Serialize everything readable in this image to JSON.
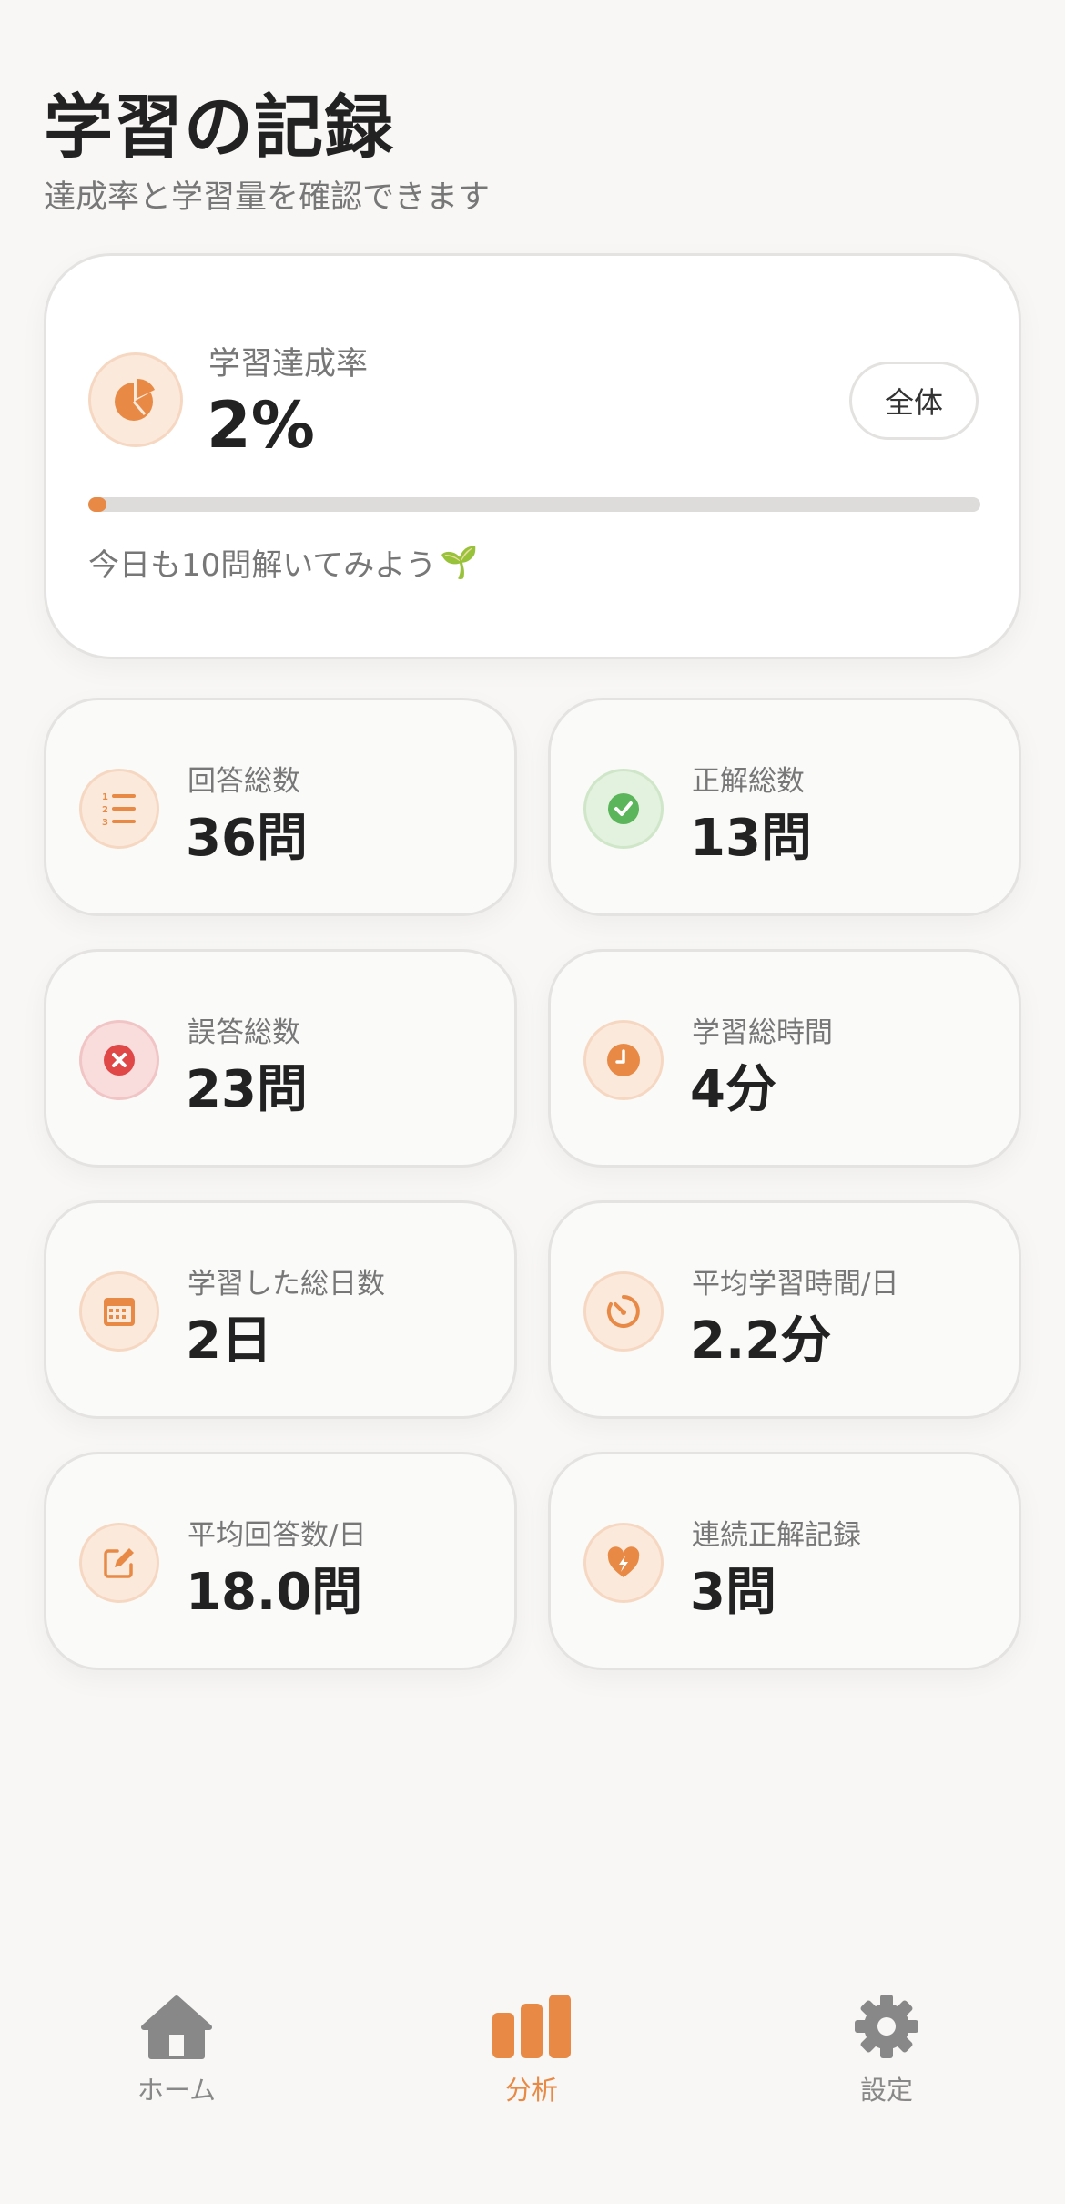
{
  "header": {
    "title": "学習の記録",
    "subtitle": "達成率と学習量を確認できます"
  },
  "summary": {
    "label": "学習達成率",
    "value": "2%",
    "progress_percent": 2,
    "scope_button": "全体",
    "message": "今日も10問解いてみよう",
    "message_emoji": "🌱",
    "icon": "pie-chart-icon"
  },
  "stats": [
    {
      "label": "回答総数",
      "value": "36問",
      "icon": "numbered-list-icon",
      "tint": "#fbe9dc",
      "color": "#e88a45"
    },
    {
      "label": "正解総数",
      "value": "13問",
      "icon": "check-circle-icon",
      "tint": "#e3f1df",
      "color": "#5bb55a"
    },
    {
      "label": "誤答総数",
      "value": "23問",
      "icon": "x-circle-icon",
      "tint": "#f9dcdc",
      "color": "#e04848"
    },
    {
      "label": "学習総時間",
      "value": "4分",
      "icon": "clock-icon",
      "tint": "#fbe9dc",
      "color": "#e88a45"
    },
    {
      "label": "学習した総日数",
      "value": "2日",
      "icon": "calendar-icon",
      "tint": "#fbe9dc",
      "color": "#e88a45"
    },
    {
      "label": "平均学習時間/日",
      "value": "2.2分",
      "icon": "timer-icon",
      "tint": "#fbe9dc",
      "color": "#e88a45"
    },
    {
      "label": "平均回答数/日",
      "value": "18.0問",
      "icon": "edit-icon",
      "tint": "#fbe9dc",
      "color": "#e88a45"
    },
    {
      "label": "連続正解記録",
      "value": "3問",
      "icon": "heart-bolt-icon",
      "tint": "#fbe9dc",
      "color": "#e88a45"
    }
  ],
  "nav": {
    "home": "ホーム",
    "analysis": "分析",
    "settings": "設定",
    "active": "analysis",
    "active_color": "#e88a45",
    "inactive_color": "#888888"
  }
}
